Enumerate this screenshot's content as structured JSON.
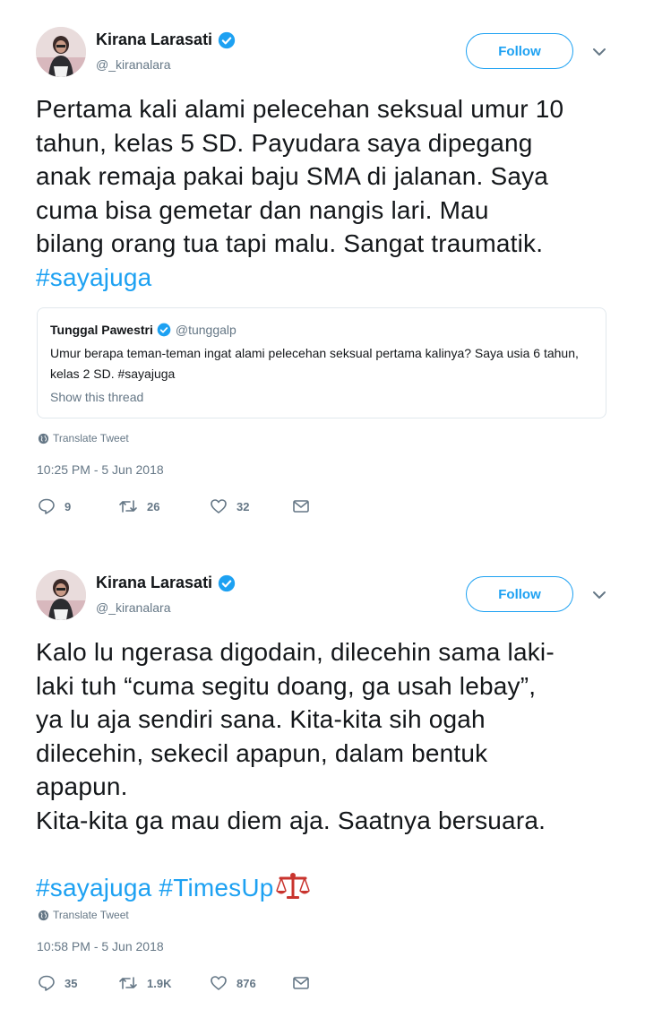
{
  "tweets": [
    {
      "author": {
        "name": "Kirana Larasati",
        "handle": "@_kiranalara"
      },
      "follow_label": "Follow",
      "lines": [
        "Pertama kali alami pelecehan seksual umur 10",
        "tahun, kelas 5 SD. Payudara saya dipegang",
        "anak remaja pakai baju SMA di jalanan. Saya",
        "cuma bisa gemetar dan nangis lari. Mau",
        "bilang orang tua tapi malu. Sangat traumatik."
      ],
      "hashtags": "#sayajuga",
      "quote": {
        "name": "Tunggal Pawestri",
        "handle": "@tunggalp",
        "text": "Umur berapa teman-teman ingat alami pelecehan seksual pertama kalinya? Saya usia 6 tahun, kelas 2 SD. #sayajuga",
        "show_thread": "Show this thread"
      },
      "translate_label": "Translate Tweet",
      "timestamp": "10:25 PM - 5 Jun 2018",
      "stats": {
        "replies": "9",
        "retweets": "26",
        "likes": "32"
      }
    },
    {
      "author": {
        "name": "Kirana Larasati",
        "handle": "@_kiranalara"
      },
      "follow_label": "Follow",
      "lines": [
        "Kalo lu ngerasa digodain, dilecehin sama laki-",
        "laki tuh “cuma segitu doang, ga usah lebay”,",
        "ya lu aja sendiri sana. Kita-kita sih ogah",
        "dilecehin, sekecil apapun, dalam bentuk",
        "apapun.",
        "Kita-kita ga mau diem aja. Saatnya bersuara."
      ],
      "hashtags": "#sayajuga #TimesUp",
      "translate_label": "Translate Tweet",
      "timestamp": "10:58 PM - 5 Jun 2018",
      "stats": {
        "replies": "35",
        "retweets": "1.9K",
        "likes": "876"
      }
    }
  ],
  "icons": [
    "verified-icon",
    "chevron-down-icon",
    "globe-icon",
    "reply-icon",
    "retweet-icon",
    "like-icon",
    "dm-icon",
    "scales-emoji"
  ],
  "colors": {
    "accent": "#1da1f2",
    "text": "#14171a",
    "muted": "#657786",
    "border": "#e1e8ed"
  }
}
